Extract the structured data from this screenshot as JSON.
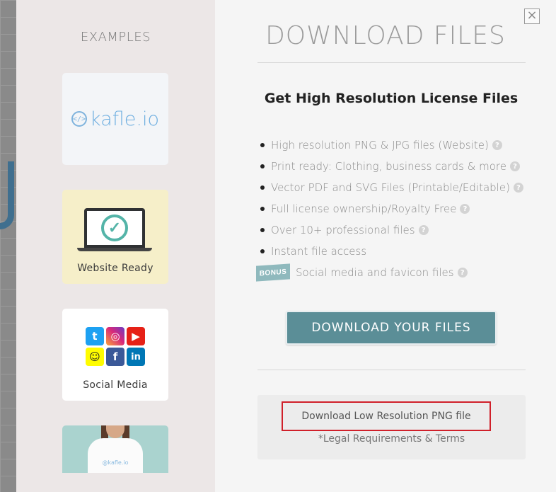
{
  "examples": {
    "title": "EXAMPLES",
    "logo_text": "kafle.io",
    "logo_symbol": "</>",
    "cards": [
      {
        "caption": "Website Ready"
      },
      {
        "caption": "Social Media"
      }
    ],
    "shirt_print": "@kafle.io"
  },
  "modal": {
    "close_symbol": "×",
    "title": "DOWNLOAD FILES",
    "subtitle": "Get High Resolution License Files",
    "features": [
      {
        "text": "High resolution PNG & JPG files (Website)",
        "help": true
      },
      {
        "text": "Print ready: Clothing, business cards & more",
        "help": true
      },
      {
        "text": "Vector PDF and SVG Files (Printable/Editable)",
        "help": true
      },
      {
        "text": "Full license ownership/Royalty Free",
        "help": true
      },
      {
        "text": "Over 10+ professional files",
        "help": true
      },
      {
        "text": "Instant file access",
        "help": false
      }
    ],
    "bonus": {
      "badge": "BONUS",
      "text": "Social media and favicon files"
    },
    "help_symbol": "?",
    "download_button": "DOWNLOAD YOUR FILES",
    "low_res_link": "Download Low Resolution PNG file",
    "legal_link": "*Legal Requirements & Terms"
  },
  "colors": {
    "accent": "#5b8e97",
    "highlight_border": "#d0202a",
    "sidebar_bg": "#ece7e7"
  }
}
